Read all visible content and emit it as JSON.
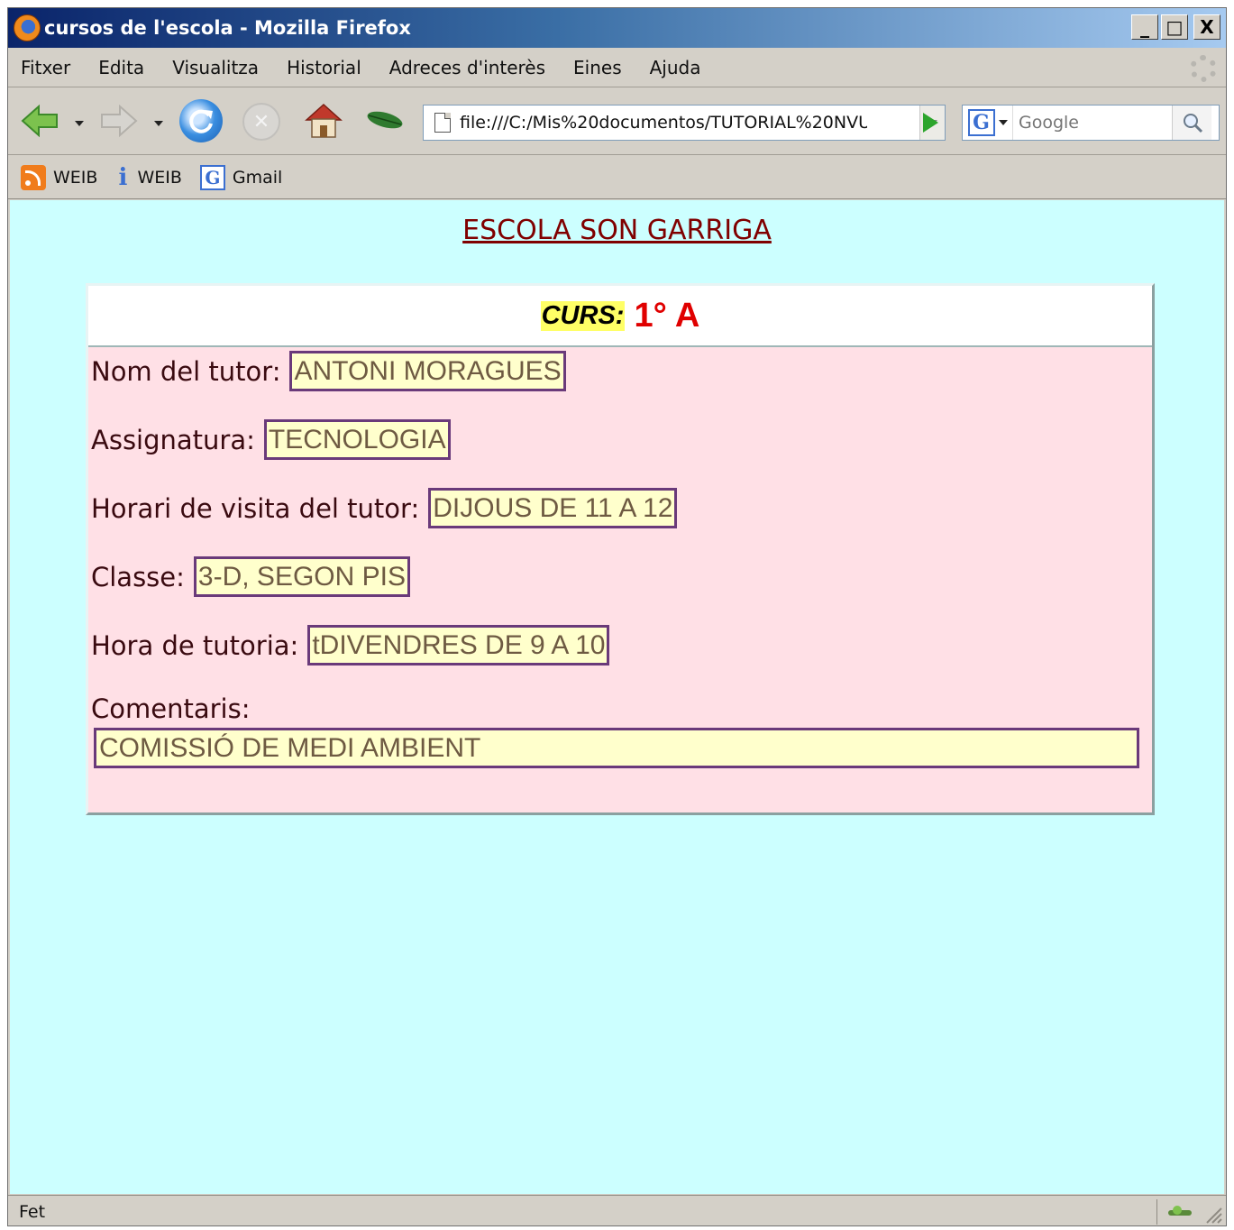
{
  "window": {
    "title": "cursos de l'escola - Mozilla Firefox",
    "controls": {
      "minimize": "_",
      "maximize": "□",
      "close": "X"
    }
  },
  "menu": [
    "Fitxer",
    "Edita",
    "Visualitza",
    "Historial",
    "Adreces d'interès",
    "Eines",
    "Ajuda"
  ],
  "toolbar": {
    "url": "file:///C:/Mis%20documentos/TUTORIAL%20NVU",
    "search_placeholder": "Google",
    "icons": [
      "back-icon",
      "forward-icon",
      "reload-icon",
      "stop-icon",
      "home-icon",
      "leaf-icon",
      "go-icon",
      "google-icon",
      "search-icon"
    ]
  },
  "bookmarks": [
    {
      "label": "WEIB",
      "icon": "rss-icon"
    },
    {
      "label": "WEIB",
      "icon": "info-icon"
    },
    {
      "label": "Gmail",
      "icon": "google-icon"
    }
  ],
  "page": {
    "heading": "ESCOLA SON GARRIGA",
    "curs_label": "CURS:",
    "curs_value": "1° A",
    "fields": [
      {
        "label": "Nom del tutor:",
        "value": "ANTONI MORAGUES"
      },
      {
        "label": "Assignatura:",
        "value": "TECNOLOGIA"
      },
      {
        "label": "Horari de visita del tutor:",
        "value": "DIJOUS DE 11 A 12"
      },
      {
        "label": "Classe:",
        "value": "3-D, SEGON PIS"
      },
      {
        "label": "Hora de tutoria:",
        "value": "tDIVENDRES DE 9 A 10"
      }
    ],
    "comments_label": "Comentaris:",
    "comments_value": "COMISSIÓ DE MEDI AMBIENT"
  },
  "status": {
    "text": "Fet"
  },
  "colors": {
    "content_bg": "#ccffff",
    "card_bg": "#ffe0e6",
    "field_bg": "#ffffcc",
    "field_border": "#6a3a7a",
    "heading": "#800000",
    "curs_value": "#e00000",
    "curs_highlight": "#ffff66"
  }
}
